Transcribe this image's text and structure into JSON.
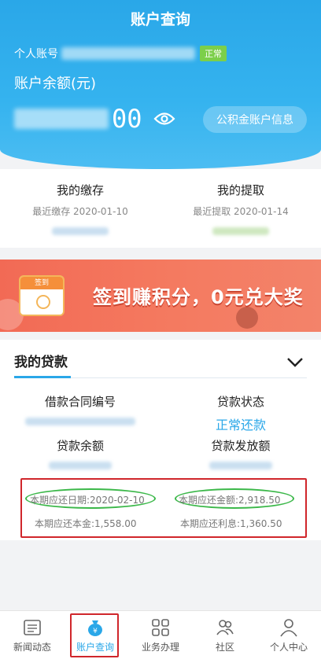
{
  "header": {
    "title": "账户查询"
  },
  "account": {
    "label": "个人账号",
    "status": "正常",
    "balance_label": "账户余额(元)",
    "balance_visible_digits": "00",
    "info_button": "公积金账户信息"
  },
  "payments": {
    "deposit": {
      "title": "我的缴存",
      "date_text": "最近缴存 2020-01-10"
    },
    "withdraw": {
      "title": "我的提取",
      "date_text": "最近提取 2020-01-14"
    }
  },
  "banner": {
    "calendar_label": "签到",
    "text": "签到赚积分，0元兑大奖"
  },
  "loan": {
    "heading": "我的贷款",
    "contract_no_label": "借款合同编号",
    "status_label": "贷款状态",
    "status_value": "正常还款",
    "balance_label": "贷款余额",
    "issued_label": "贷款发放额",
    "due_date": "本期应还日期:2020-02-10",
    "due_amount": "本期应还金额:2,918.50",
    "principal": "本期应还本金:1,558.00",
    "interest": "本期应还利息:1,360.50"
  },
  "tabs": [
    {
      "label": "新闻动态",
      "icon": "news-icon"
    },
    {
      "label": "账户查询",
      "icon": "money-bag-icon"
    },
    {
      "label": "业务办理",
      "icon": "grid-icon"
    },
    {
      "label": "社区",
      "icon": "community-icon"
    },
    {
      "label": "个人中心",
      "icon": "person-icon"
    }
  ],
  "colors": {
    "primary": "#2aa7e8",
    "banner": "#f26a55",
    "highlight": "#d0262b",
    "oval": "#3cb84a",
    "status_tag": "#7ccf4a"
  }
}
